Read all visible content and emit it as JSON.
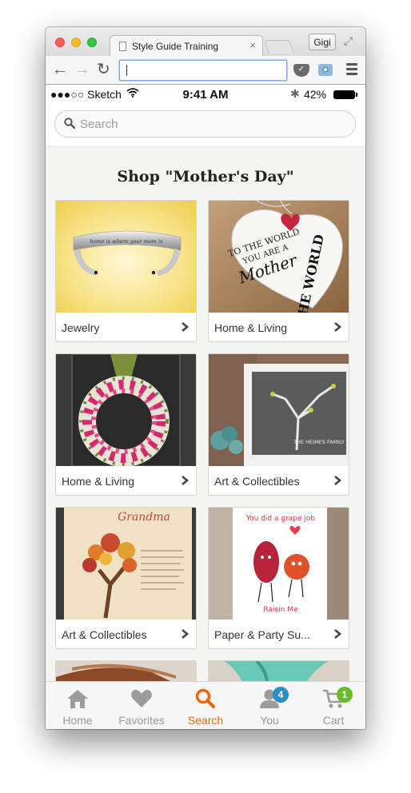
{
  "browser": {
    "tab_title": "Style Guide Training",
    "tab_close": "×",
    "profile_name": "Gigi",
    "address_value": "",
    "nav_back": "←",
    "nav_forward": "→",
    "nav_reload": "↻"
  },
  "status_bar": {
    "carrier": "●●●○○ Sketch",
    "time": "9:41 AM",
    "bluetooth": "✱",
    "battery": "42%"
  },
  "search": {
    "placeholder": "Search"
  },
  "page": {
    "heading": "Shop \"Mother's Day\""
  },
  "categories": [
    {
      "label": "Jewelry",
      "image": "silver-cuff-bracelet"
    },
    {
      "label": "Home & Living",
      "image": "heart-plaque-to-the-world"
    },
    {
      "label": "Home & Living",
      "image": "tulip-wreath"
    },
    {
      "label": "Art & Collectibles",
      "image": "family-tree-print"
    },
    {
      "label": "Art & Collectibles",
      "image": "grandma-tree-print"
    },
    {
      "label": "Paper & Party Su...",
      "image": "grape-job-card"
    }
  ],
  "tab_bar": {
    "items": [
      {
        "label": "Home",
        "icon": "house-icon",
        "badge": null
      },
      {
        "label": "Favorites",
        "icon": "heart-icon",
        "badge": null
      },
      {
        "label": "Search",
        "icon": "search-icon",
        "badge": null
      },
      {
        "label": "You",
        "icon": "person-icon",
        "badge": "4"
      },
      {
        "label": "Cart",
        "icon": "cart-icon",
        "badge": "1"
      }
    ],
    "active": "Search"
  },
  "colors": {
    "accent_orange": "#f56400",
    "badge_blue": "#2a8dc5",
    "badge_green": "#6cba2e",
    "page_bg": "#f5f5f1"
  }
}
